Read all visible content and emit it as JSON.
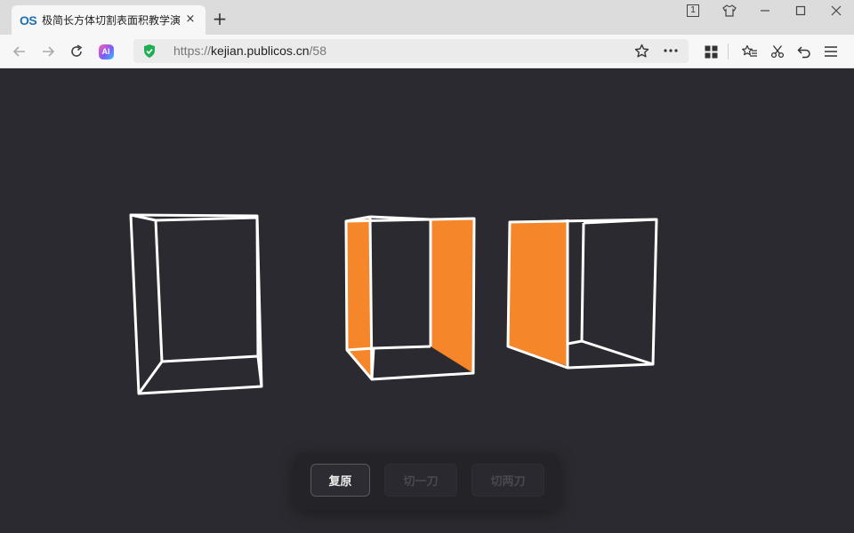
{
  "browser": {
    "tab": {
      "favicon_text": "OS",
      "title": "极简长方体切割表面积教学演",
      "close_glyph": "×"
    },
    "new_tab_glyph": "+",
    "window": {
      "tab_count": "1"
    },
    "address": {
      "scheme": "https://",
      "host": "kejian.publicos.cn",
      "path": "/58"
    },
    "ai_label": "AI"
  },
  "controls": {
    "reset_label": "复原",
    "cut_one_label": "切一刀",
    "cut_two_label": "切两刀"
  },
  "colors": {
    "stage_bg": "#2b2a30",
    "edge": "#ffffff",
    "face_highlight": "#f5862a",
    "secure_shield": "#1fae54"
  }
}
